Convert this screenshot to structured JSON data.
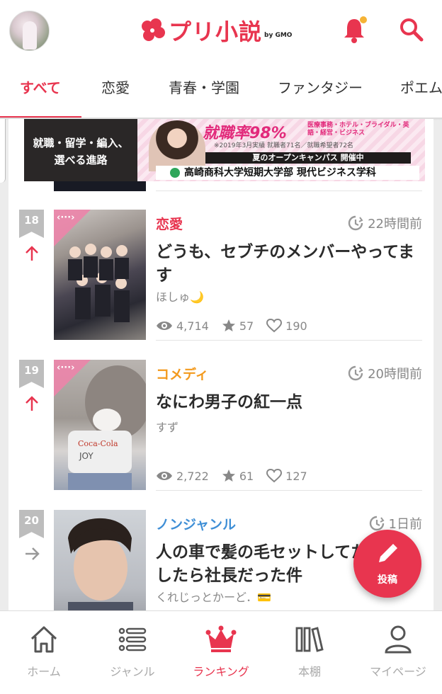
{
  "header": {
    "logo_text": "プリ小説",
    "logo_by": "by GMO",
    "avatar_icon": "user-avatar",
    "notification_icon": "bell-icon",
    "search_icon": "search-icon",
    "accent_color": "#e8354f"
  },
  "tabs": [
    {
      "label": "すべて",
      "active": true
    },
    {
      "label": "恋愛",
      "active": false
    },
    {
      "label": "青春・学園",
      "active": false
    },
    {
      "label": "ファンタジー",
      "active": false
    },
    {
      "label": "ポエム",
      "active": false
    }
  ],
  "banner": {
    "left_line1": "就職・留学・編入、",
    "left_line2": "選べる進路",
    "rate": "就職率98%",
    "subjects": "医療事務・ホテル・ブライダル・英語・経営・ビジネス",
    "note": "※2019年3月実績 就職者71名／就職希望者72名",
    "open_campus": "夏のオープンキャンパス 開催中",
    "school": "高崎商科大学短期大学部 現代ビジネス学科"
  },
  "items": [
    {
      "rank": "18",
      "trend": "up",
      "genre": "恋愛",
      "genre_color": "#e8354f",
      "time": "22時間前",
      "title": "どうも、セブチのメンバーやってます",
      "author": "ほしゅ🌙",
      "views": "4,714",
      "stars": "57",
      "likes": "190"
    },
    {
      "rank": "19",
      "trend": "up",
      "genre": "コメディ",
      "genre_color": "#f39a1e",
      "time": "20時間前",
      "title": "なにわ男子の紅一点",
      "author": "すず",
      "views": "2,722",
      "stars": "61",
      "likes": "127"
    },
    {
      "rank": "20",
      "trend": "flat",
      "genre": "ノンジャンル",
      "genre_color": "#3f8fd6",
      "time": "1日前",
      "title": "人の車で髪の毛セットしてたら注意したら社長だった件",
      "author": "くれじっとかーど．💳"
    }
  ],
  "fab": {
    "label": "投稿",
    "icon": "pencil-icon"
  },
  "bottom_nav": [
    {
      "label": "ホーム",
      "icon": "home-icon",
      "active": false
    },
    {
      "label": "ジャンル",
      "icon": "list-icon",
      "active": false
    },
    {
      "label": "ランキング",
      "icon": "crown-icon",
      "active": true
    },
    {
      "label": "本棚",
      "icon": "bookshelf-icon",
      "active": false
    },
    {
      "label": "マイページ",
      "icon": "person-icon",
      "active": false
    }
  ]
}
